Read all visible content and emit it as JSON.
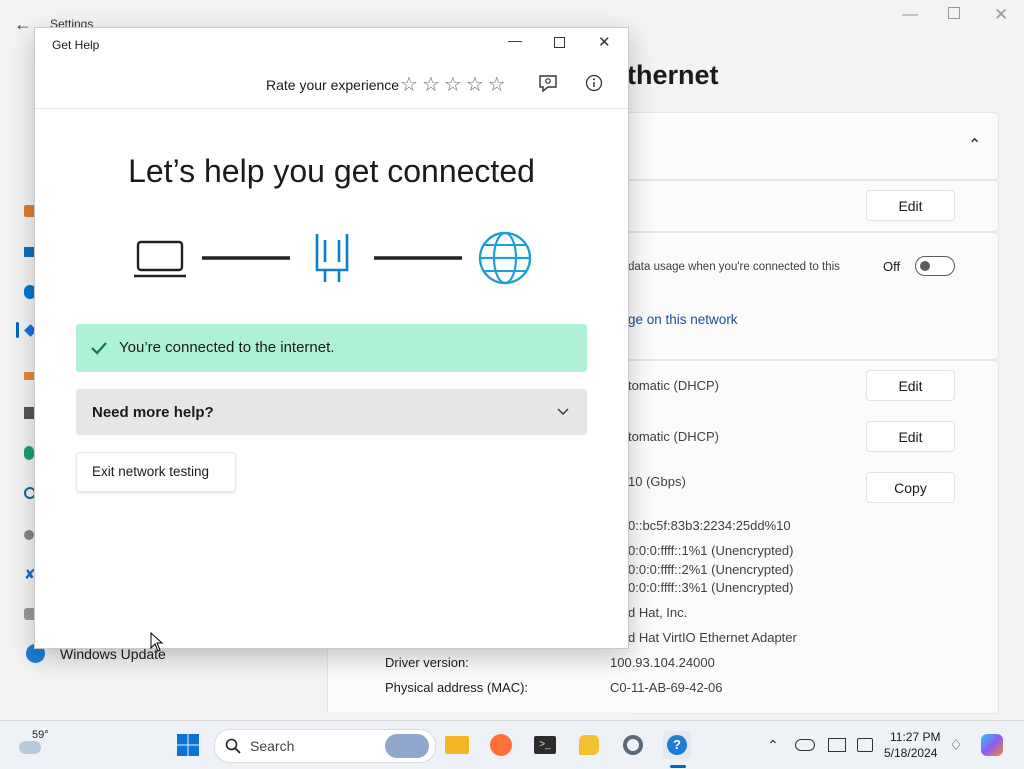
{
  "settings": {
    "app_title": "Settings",
    "page_title_fragment": "thernet",
    "nav_windows_update": "Windows Update",
    "metered_text_fragment": "data usage when you're connected to this",
    "toggle_state": "Off",
    "link_fragment": "ge on this network",
    "edit_label": "Edit",
    "copy_label": "Copy",
    "ip_assign_fragment": "tomatic (DHCP)",
    "dns_assign_fragment": "tomatic (DHCP)",
    "link_speed_fragment": "10 (Gbps)",
    "ipv6_fragment": "0::bc5f:83b3:2234:25dd%10",
    "dns_servers": [
      "0:0:0:ffff::1%1 (Unencrypted)",
      "0:0:0:ffff::2%1 (Unencrypted)",
      "0:0:0:ffff::3%1 (Unencrypted)"
    ],
    "manufacturer_fragment": "d Hat, Inc.",
    "description_fragment": "d Hat VirtIO Ethernet Adapter",
    "driver_label": "Driver version:",
    "driver_value": "100.93.104.24000",
    "mac_label": "Physical address (MAC):",
    "mac_value": "C0-11-AB-69-42-06"
  },
  "gethelp": {
    "window_title": "Get Help",
    "rate_label": "Rate your experience",
    "star_count": 5,
    "heading": "Let’s help you get connected",
    "status_text": "You’re connected to the internet.",
    "more_help": "Need more help?",
    "exit_button": "Exit network testing"
  },
  "taskbar": {
    "weather_temp": "59°",
    "search_placeholder": "Search",
    "time": "11:27 PM",
    "date": "5/18/2024"
  },
  "colors": {
    "accent": "#0078d4",
    "success_banner": "#aef1d6",
    "success_check": "#107c41",
    "network_icon": "#0b80c8",
    "globe_icon": "#1f9fd6"
  }
}
